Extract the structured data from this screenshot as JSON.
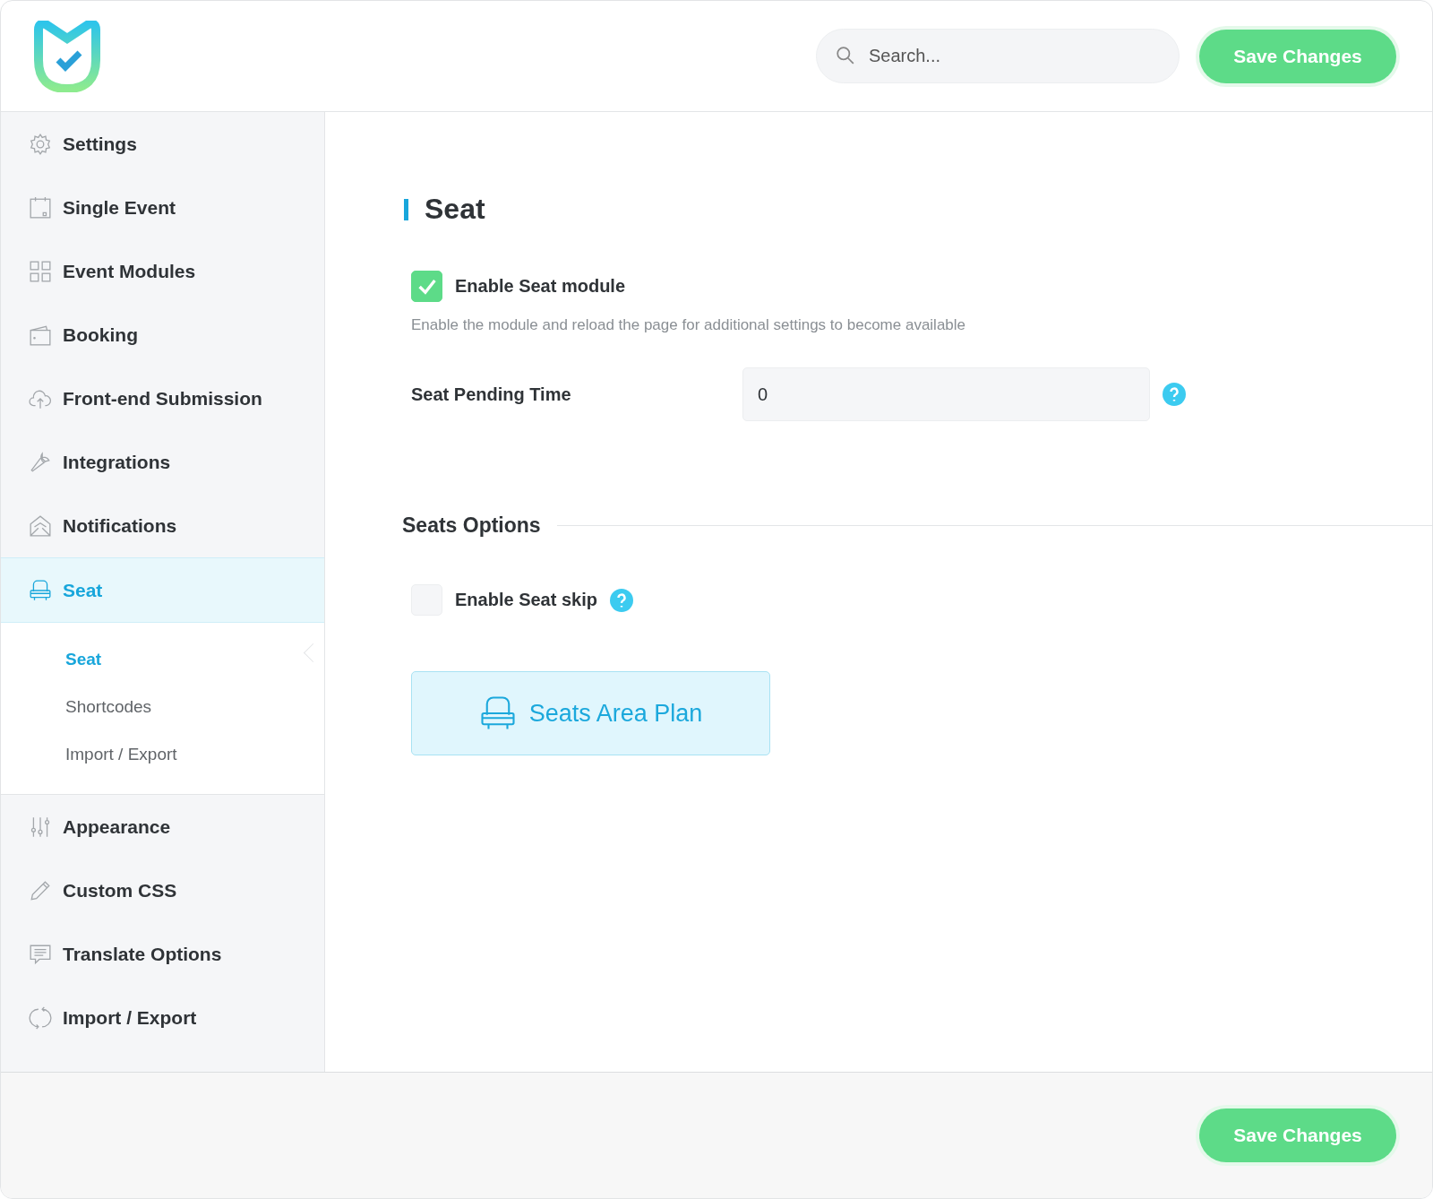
{
  "header": {
    "search": {
      "placeholder": "Search..."
    },
    "save_button": "Save Changes"
  },
  "sidebar": {
    "items": [
      {
        "label": "Settings",
        "selected": false
      },
      {
        "label": "Single Event",
        "selected": false
      },
      {
        "label": "Event Modules",
        "selected": false
      },
      {
        "label": "Booking",
        "selected": false
      },
      {
        "label": "Front-end Submission",
        "selected": false
      },
      {
        "label": "Integrations",
        "selected": false
      },
      {
        "label": "Notifications",
        "selected": false
      },
      {
        "label": "Seat",
        "selected": true,
        "children": [
          {
            "label": "Seat",
            "selected": true
          },
          {
            "label": "Shortcodes",
            "selected": false
          },
          {
            "label": "Import / Export",
            "selected": false
          }
        ]
      },
      {
        "label": "Appearance",
        "selected": false
      },
      {
        "label": "Custom CSS",
        "selected": false
      },
      {
        "label": "Translate Options",
        "selected": false
      },
      {
        "label": "Import / Export",
        "selected": false
      }
    ]
  },
  "content": {
    "title": "Seat",
    "enable_module": {
      "label": "Enable Seat module",
      "checked": true
    },
    "description": "Enable the module and reload the page for additional settings to become available",
    "pending_time": {
      "label": "Seat Pending Time",
      "value": "0"
    },
    "section_title": "Seats Options",
    "enable_skip": {
      "label": "Enable Seat skip",
      "checked": false
    },
    "area_plan_button": "Seats Area Plan"
  },
  "footer": {
    "save_button": "Save Changes"
  }
}
